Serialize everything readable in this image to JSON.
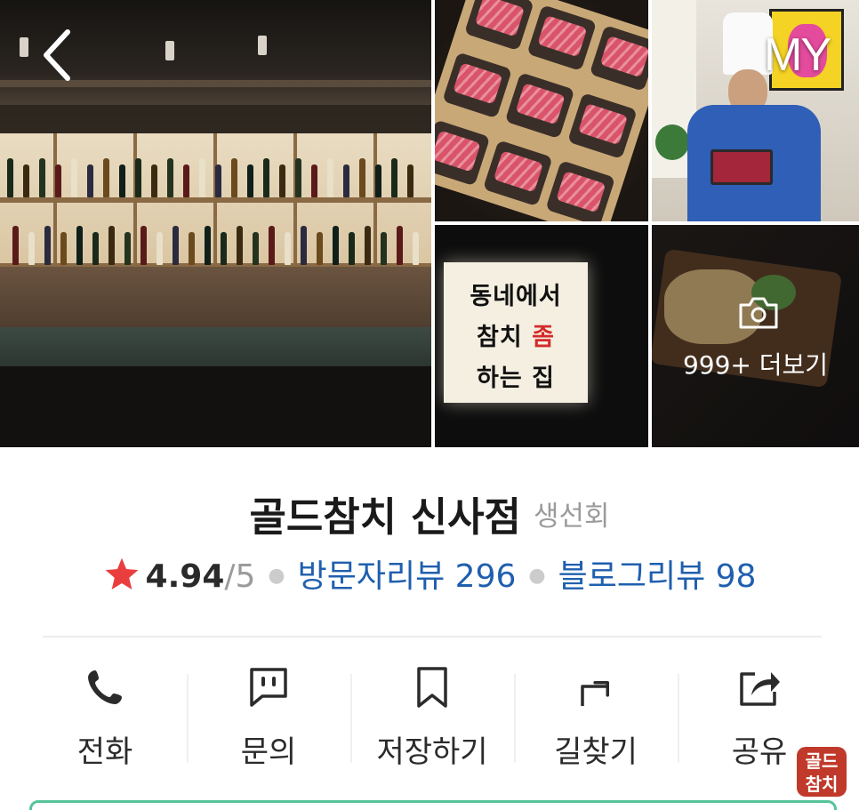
{
  "header": {
    "back_label": "back",
    "my_label": "MY"
  },
  "gallery": {
    "sign_lines": [
      "동네에서",
      "참치 ",
      "좀",
      "하는 집"
    ],
    "more_label": "999+ 더보기"
  },
  "place": {
    "name": "골드참치 신사점",
    "category": "생선회",
    "rating": "4.94",
    "rating_max": "/5",
    "visitor_review_label": "방문자리뷰 296",
    "blog_review_label": "블로그리뷰 98"
  },
  "actions": [
    {
      "label": "전화",
      "icon": "phone-icon"
    },
    {
      "label": "문의",
      "icon": "chat-icon"
    },
    {
      "label": "저장하기",
      "icon": "bookmark-icon"
    },
    {
      "label": "길찾기",
      "icon": "directions-icon"
    },
    {
      "label": "공유",
      "icon": "share-icon"
    }
  ],
  "seal": {
    "text": "골드참치"
  },
  "colors": {
    "star": "#ea3e3e",
    "link": "#1f5fae",
    "accent_border": "#55c49a"
  }
}
